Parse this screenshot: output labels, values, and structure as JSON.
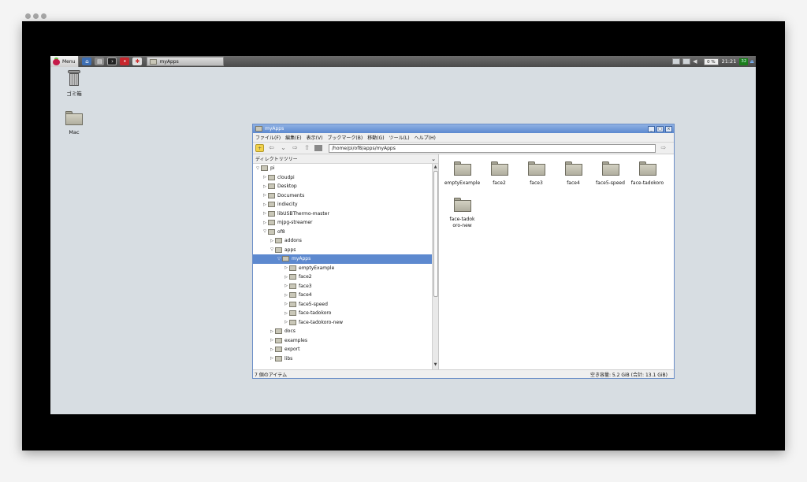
{
  "taskbar": {
    "menu_label": "Menu",
    "task_label": "myApps",
    "cpu": "0 %",
    "clock": "21:21",
    "temp": "32"
  },
  "desktop": {
    "icons": [
      {
        "label": "ゴミ箱",
        "icon": "trash-icon"
      },
      {
        "label": "Mac",
        "icon": "folder-icon"
      }
    ]
  },
  "file_manager": {
    "title": "myApps",
    "menu": [
      "ファイル(F)",
      "編集(E)",
      "表示(V)",
      "ブックマーク(B)",
      "移動(G)",
      "ツール(L)",
      "ヘルプ(H)"
    ],
    "path": "/home/pi/of8/apps/myApps",
    "tree_header": "ディレクトリツリー",
    "tree": [
      {
        "label": "pi",
        "depth": 0,
        "expanded": true
      },
      {
        "label": "cloudpi",
        "depth": 1,
        "expanded": false
      },
      {
        "label": "Desktop",
        "depth": 1,
        "expanded": false
      },
      {
        "label": "Documents",
        "depth": 1,
        "expanded": false
      },
      {
        "label": "indiecity",
        "depth": 1,
        "expanded": false
      },
      {
        "label": "libUSBThermo-master",
        "depth": 1,
        "expanded": false
      },
      {
        "label": "mjpg-streamer",
        "depth": 1,
        "expanded": false
      },
      {
        "label": "of8",
        "depth": 1,
        "expanded": true
      },
      {
        "label": "addons",
        "depth": 2,
        "expanded": false
      },
      {
        "label": "apps",
        "depth": 2,
        "expanded": true
      },
      {
        "label": "myApps",
        "depth": 3,
        "expanded": true,
        "selected": true
      },
      {
        "label": "emptyExample",
        "depth": 4,
        "expanded": false
      },
      {
        "label": "face2",
        "depth": 4,
        "expanded": false
      },
      {
        "label": "face3",
        "depth": 4,
        "expanded": false
      },
      {
        "label": "face4",
        "depth": 4,
        "expanded": false
      },
      {
        "label": "face5-speed",
        "depth": 4,
        "expanded": false
      },
      {
        "label": "face-tadokoro",
        "depth": 4,
        "expanded": false
      },
      {
        "label": "face-tadokoro-new",
        "depth": 4,
        "expanded": false
      },
      {
        "label": "docs",
        "depth": 2,
        "expanded": false
      },
      {
        "label": "examples",
        "depth": 2,
        "expanded": false
      },
      {
        "label": "export",
        "depth": 2,
        "expanded": false
      },
      {
        "label": "libs",
        "depth": 2,
        "expanded": false
      }
    ],
    "files": [
      {
        "label": "emptyExample"
      },
      {
        "label": "face2"
      },
      {
        "label": "face3"
      },
      {
        "label": "face4"
      },
      {
        "label": "face5-speed"
      },
      {
        "label": "face-tadokoro"
      },
      {
        "label": "face-tadokoro-new"
      }
    ],
    "status_left": "7 個のアイテム",
    "status_right": "空き容量: 5.2 GiB (合計: 13.1 GiB)"
  }
}
